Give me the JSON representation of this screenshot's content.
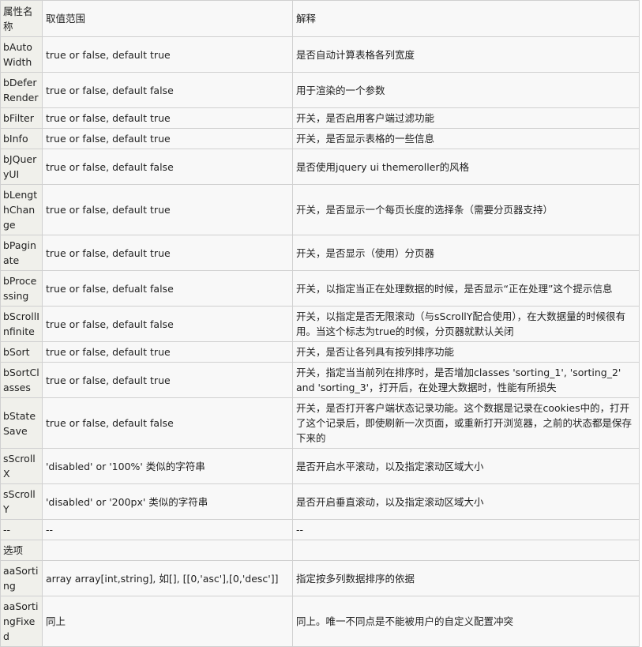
{
  "header": {
    "name": "属性名称",
    "range": "取值范围",
    "desc": "解释"
  },
  "rows": [
    {
      "name": "bAutoWidth",
      "range": "true or false, default true",
      "desc": "是否自动计算表格各列宽度"
    },
    {
      "name": "bDeferRender",
      "range": "true or false, default false",
      "desc": "用于渲染的一个参数"
    },
    {
      "name": "bFilter",
      "range": "true or false, default true",
      "desc": "开关，是否启用客户端过滤功能"
    },
    {
      "name": "bInfo",
      "range": "true or false, default true",
      "desc": "开关，是否显示表格的一些信息"
    },
    {
      "name": "bJQueryUI",
      "range": "true or false, default false",
      "desc": "是否使用jquery ui themeroller的风格"
    },
    {
      "name": "bLengthChange",
      "range": "true or false, default true",
      "desc": "开关，是否显示一个每页长度的选择条（需要分页器支持）"
    },
    {
      "name": "bPaginate",
      "range": "true or false, default true",
      "desc": "开关，是否显示（使用）分页器"
    },
    {
      "name": "bProcessing",
      "range": "true or false, defualt false",
      "desc": "开关，以指定当正在处理数据的时候，是否显示“正在处理”这个提示信息"
    },
    {
      "name": "bScrollInfinite",
      "range": "true or false, default false",
      "desc": "开关，以指定是否无限滚动（与sScrollY配合使用），在大数据量的时候很有用。当这个标志为true的时候，分页器就默认关闭"
    },
    {
      "name": "bSort",
      "range": "true or false, default true",
      "desc": "开关，是否让各列具有按列排序功能"
    },
    {
      "name": "bSortClasses",
      "range": "true or false, default true",
      "desc": "开关，指定当当前列在排序时，是否增加classes 'sorting_1', 'sorting_2' and 'sorting_3'，打开后，在处理大数据时，性能有所损失"
    },
    {
      "name": "bStateSave",
      "range": "true or false, default false",
      "desc": "开关，是否打开客户端状态记录功能。这个数据是记录在cookies中的，打开了这个记录后，即使刷新一次页面，或重新打开浏览器，之前的状态都是保存下来的"
    },
    {
      "name": "sScrollX",
      "range": "'disabled' or  '100%' 类似的字符串",
      "desc": "是否开启水平滚动，以及指定滚动区域大小"
    },
    {
      "name": "sScrollY",
      "range": "'disabled' or '200px' 类似的字符串",
      "desc": "是否开启垂直滚动，以及指定滚动区域大小"
    },
    {
      "name": "--",
      "range": "--",
      "desc": "--"
    },
    {
      "name": "选项",
      "range": "",
      "desc": ""
    },
    {
      "name": "aaSorting",
      "range": "array array[int,string], 如[], [[0,'asc'],[0,'desc']]",
      "desc": "指定按多列数据排序的依据"
    },
    {
      "name": "aaSortingFixed",
      "range": "同上",
      "desc": "同上。唯一不同点是不能被用户的自定义配置冲突"
    }
  ]
}
